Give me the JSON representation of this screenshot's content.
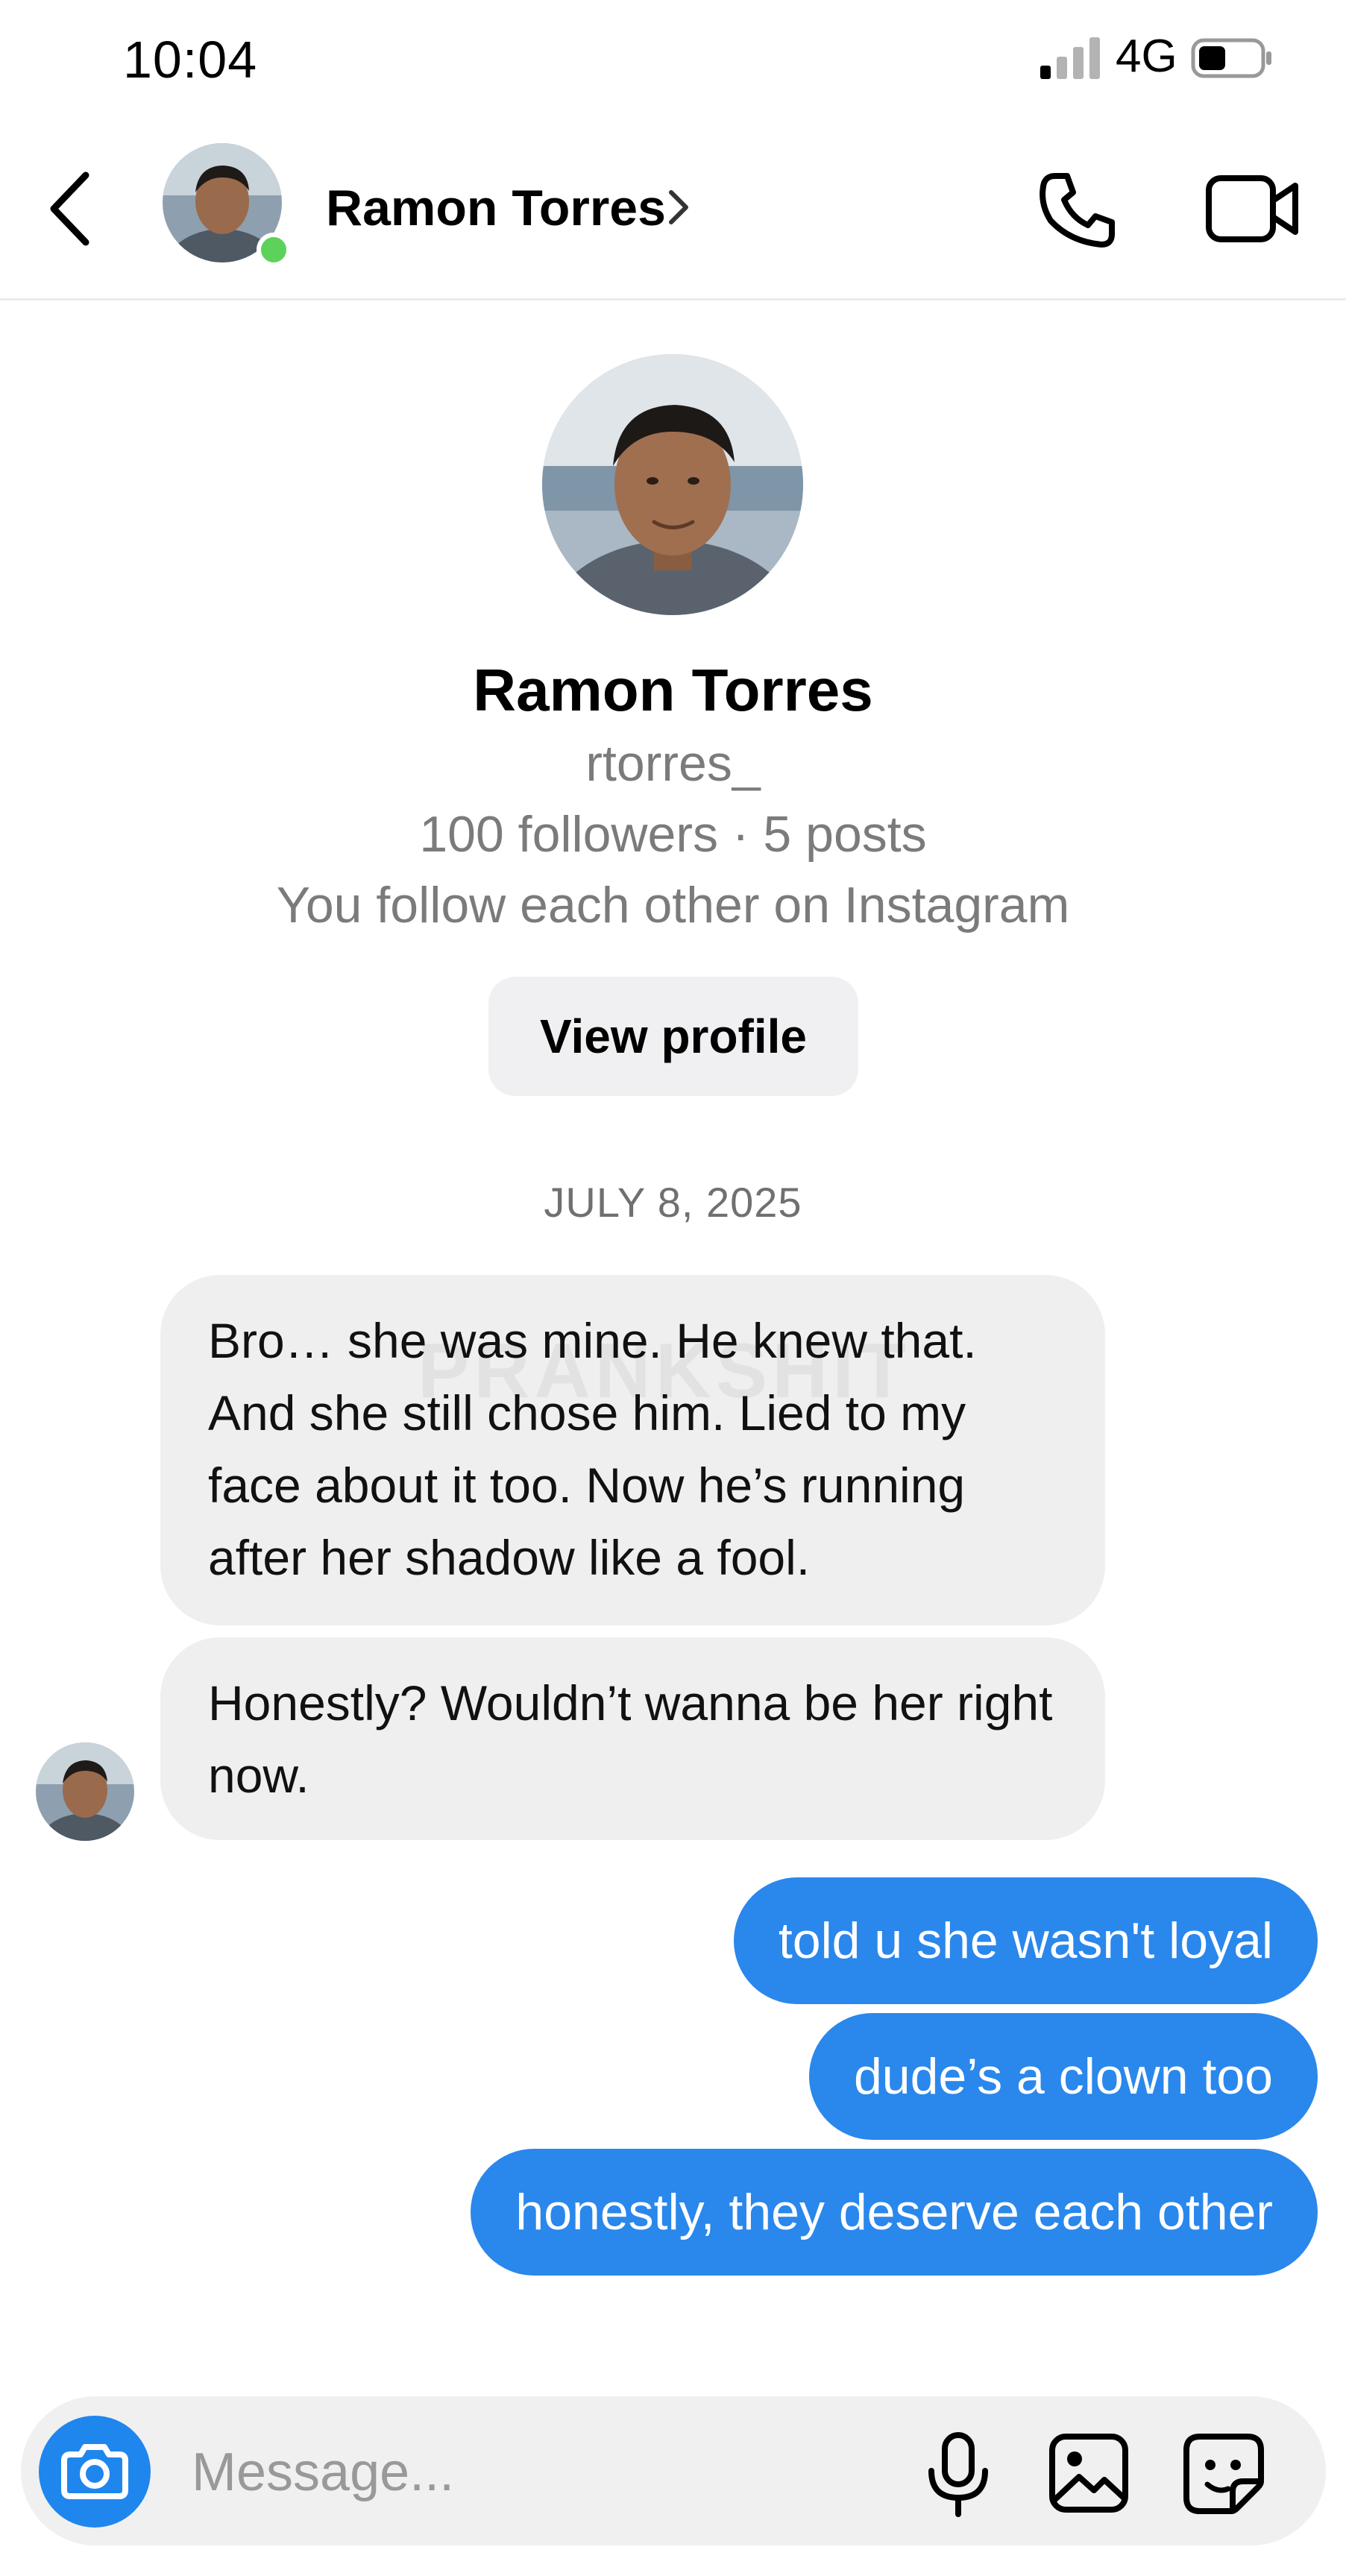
{
  "status_bar": {
    "time": "10:04",
    "network": "4G",
    "signal_icon": "signal-bars-icon",
    "battery_icon": "battery-icon",
    "battery_level": 0.45
  },
  "header": {
    "back_icon": "chevron-left-icon",
    "name": "Ramon Torres",
    "online": true,
    "chevron_icon": "chevron-right-icon",
    "call_icon": "phone-icon",
    "video_icon": "video-camera-icon"
  },
  "profile": {
    "name": "Ramon Torres",
    "username": "rtorres_",
    "stats": "100 followers · 5 posts",
    "mutual": "You follow each other on Instagram",
    "view_profile_label": "View profile"
  },
  "date_divider": "JULY 8, 2025",
  "messages_incoming": [
    {
      "text": "Bro… she was mine. He knew that. And she still chose him. Lied to my face about it too. Now he’s running after her shadow like a fool."
    },
    {
      "text": "Honestly? Wouldn’t wanna be her right now."
    }
  ],
  "watermark": "PRANKSHIT",
  "messages_outgoing": [
    {
      "text": "told u she wasn't loyal"
    },
    {
      "text": "dude’s a clown too"
    },
    {
      "text": "honestly, they deserve each other"
    }
  ],
  "composer": {
    "placeholder": "Message...",
    "camera_icon": "camera-icon",
    "mic_icon": "microphone-icon",
    "gallery_icon": "image-gallery-icon",
    "sticker_icon": "sticker-icon"
  },
  "colors": {
    "accent_blue": "#2a87ec",
    "incoming_bubble": "#efefef",
    "online_green": "#5cd25b",
    "secondary_text": "#7b7b7b"
  }
}
